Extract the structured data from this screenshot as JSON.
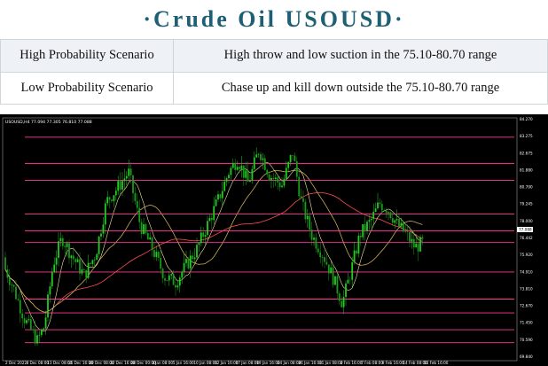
{
  "header": {
    "title": "·Crude  Oil  USOUSD·"
  },
  "scenarios": [
    {
      "label": "High Probability Scenario",
      "text": "High throw and low suction in the 75.10-80.70 range"
    },
    {
      "label": "Low Probability Scenario",
      "text": "Chase up and kill down outside the 75.10-80.70 range"
    }
  ],
  "chart": {
    "symbol_info": "USOUSD,H4  77.094 77.305 76.810 77.088",
    "levels": [
      83.33,
      81.73,
      80.7,
      78.64,
      77.62,
      76.9,
      75.1,
      73.45,
      72.61,
      71.58,
      70.79
    ],
    "price_ticks": [
      "84.270",
      "83.275",
      "82.675",
      "81.880",
      "80.700",
      "79.245",
      "78.000",
      "76.442",
      "75.920",
      "74.910",
      "73.810",
      "72.670",
      "71.450",
      "70.590",
      "69.840"
    ],
    "current_price": "77.088",
    "time_ticks": [
      "2 Dec 2022",
      "8 Dec 08:00",
      "13 Dec 08:00",
      "15 Dec 16:00",
      "20 Dec 08:00",
      "22 Dec 16:00",
      "28 Dec 00:00",
      "3 Jan 08:00",
      "5 Jan 16:00",
      "10 Jan 08:00",
      "12 Jan 16:00",
      "17 Jan 08:00",
      "19 Jan 16:00",
      "24 Jan 08:00",
      "26 Jan 16:00",
      "31 Jan 08:00",
      "2 Feb 16:00",
      "7 Feb 08:00",
      "9 Feb 16:00",
      "14 Feb 08:00",
      "16 Feb 16:00"
    ],
    "colors": {
      "bull": "#22cc22",
      "bear": "#1a9a1a",
      "level": "#ff3a9a",
      "ma1": "#f0e6a0",
      "ma2": "#c8aa55",
      "ma3": "#ff4c4c"
    }
  }
}
